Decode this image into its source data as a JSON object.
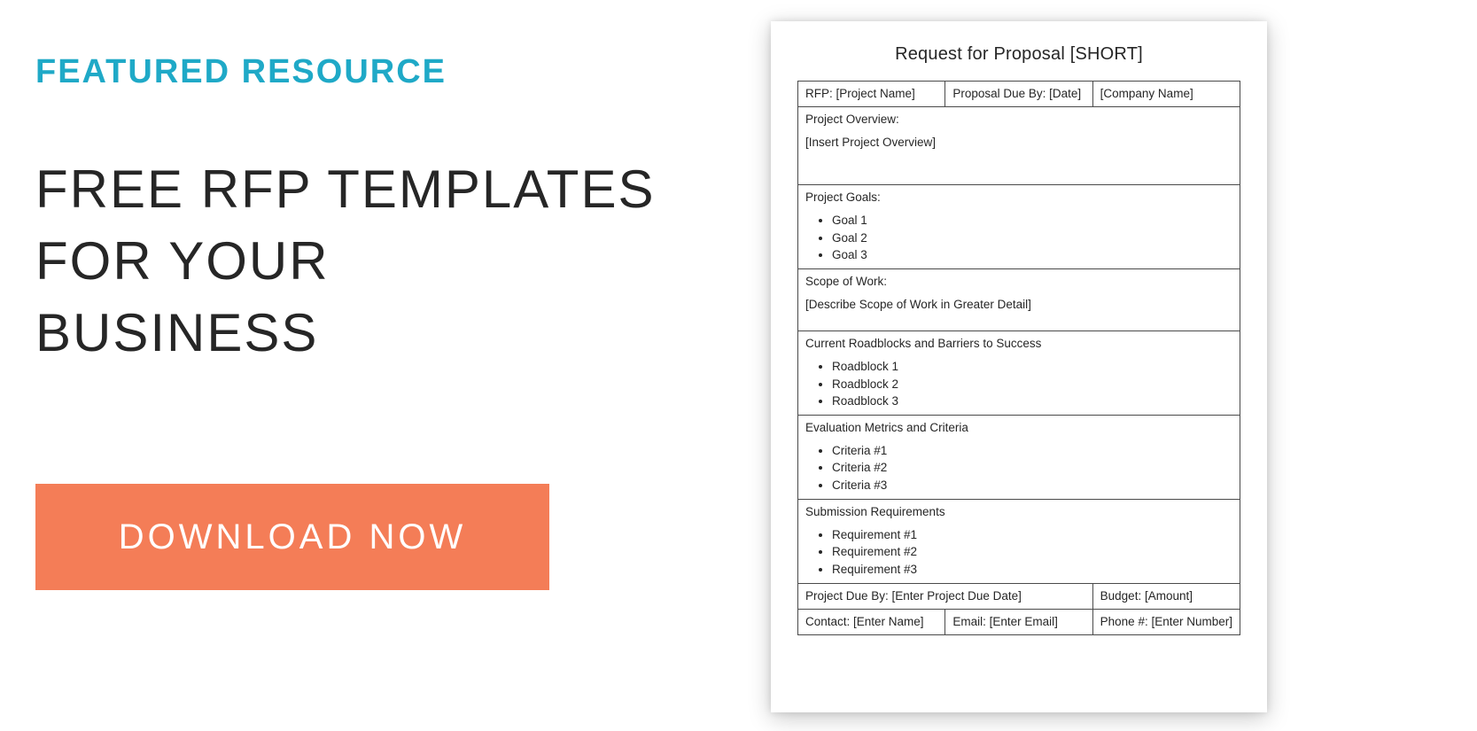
{
  "left": {
    "featured": "FEATURED RESOURCE",
    "headline_line1": "FREE RFP TEMPLATES",
    "headline_line2": "FOR YOUR",
    "headline_line3": "BUSINESS",
    "download_label": "DOWNLOAD NOW"
  },
  "doc": {
    "title": "Request for Proposal [SHORT]",
    "header_row": {
      "rfp": "RFP: [Project Name]",
      "due": "Proposal Due By: [Date]",
      "company": "[Company Name]"
    },
    "overview": {
      "heading": "Project Overview:",
      "body": "[Insert Project Overview]"
    },
    "goals": {
      "heading": "Project Goals:",
      "items": [
        "Goal 1",
        "Goal 2",
        "Goal 3"
      ]
    },
    "scope": {
      "heading": "Scope of Work:",
      "body": "[Describe Scope of Work in Greater Detail]"
    },
    "roadblocks": {
      "heading": "Current Roadblocks and Barriers to Success",
      "items": [
        "Roadblock 1",
        "Roadblock 2",
        "Roadblock 3"
      ]
    },
    "criteria": {
      "heading": "Evaluation Metrics and Criteria",
      "items": [
        "Criteria #1",
        "Criteria #2",
        "Criteria #3"
      ]
    },
    "submission": {
      "heading": "Submission Requirements",
      "items": [
        "Requirement #1",
        "Requirement #2",
        "Requirement #3"
      ]
    },
    "footer_row1": {
      "due": "Project Due By: [Enter Project Due Date]",
      "budget": "Budget: [Amount]"
    },
    "footer_row2": {
      "contact": "Contact: [Enter Name]",
      "email": "Email: [Enter Email]",
      "phone": "Phone #: [Enter Number]"
    }
  }
}
